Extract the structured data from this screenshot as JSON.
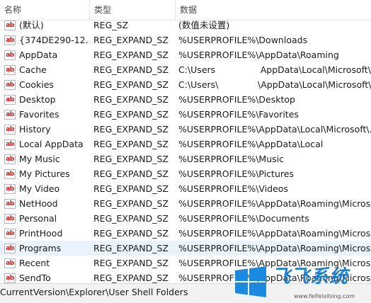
{
  "header": {
    "name": "名称",
    "type": "类型",
    "data": "数据"
  },
  "icon": {
    "label": "ab",
    "color": "#d01616"
  },
  "rows": [
    {
      "name": "(默认)",
      "type": "REG_SZ",
      "data": "(数值未设置)"
    },
    {
      "name": "{374DE290-12...",
      "type": "REG_EXPAND_SZ",
      "data": "%USERPROFILE%\\Downloads"
    },
    {
      "name": "AppData",
      "type": "REG_EXPAND_SZ",
      "data": "%USERPROFILE%\\AppData\\Roaming"
    },
    {
      "name": "Cache",
      "type": "REG_EXPAND_SZ",
      "data": "C:\\Users                AppData\\Local\\Microsoft\\Wi..."
    },
    {
      "name": "Cookies",
      "type": "REG_EXPAND_SZ",
      "data": "C:\\Users\\              \\AppData\\Local\\Microsoft\\Wi..."
    },
    {
      "name": "Desktop",
      "type": "REG_EXPAND_SZ",
      "data": "%USERPROFILE%\\Desktop"
    },
    {
      "name": "Favorites",
      "type": "REG_EXPAND_SZ",
      "data": "%USERPROFILE%\\Favorites"
    },
    {
      "name": "History",
      "type": "REG_EXPAND_SZ",
      "data": "%USERPROFILE%\\AppData\\Local\\Microsoft\\..."
    },
    {
      "name": "Local AppData",
      "type": "REG_EXPAND_SZ",
      "data": "%USERPROFILE%\\AppData\\Local"
    },
    {
      "name": "My Music",
      "type": "REG_EXPAND_SZ",
      "data": "%USERPROFILE%\\Music"
    },
    {
      "name": "My Pictures",
      "type": "REG_EXPAND_SZ",
      "data": "%USERPROFILE%\\Pictures"
    },
    {
      "name": "My Video",
      "type": "REG_EXPAND_SZ",
      "data": "%USERPROFILE%\\Videos"
    },
    {
      "name": "NetHood",
      "type": "REG_EXPAND_SZ",
      "data": "%USERPROFILE%\\AppData\\Roaming\\Micros..."
    },
    {
      "name": "Personal",
      "type": "REG_EXPAND_SZ",
      "data": "%USERPROFILE%\\Documents"
    },
    {
      "name": "PrintHood",
      "type": "REG_EXPAND_SZ",
      "data": "%USERPROFILE%\\AppData\\Roaming\\Micros..."
    },
    {
      "name": "Programs",
      "type": "REG_EXPAND_SZ",
      "data": "%USERPROFILE%\\AppData\\Roaming\\Micros...",
      "selected": true
    },
    {
      "name": "Recent",
      "type": "REG_EXPAND_SZ",
      "data": "%USERPROFILE%\\AppData\\Roaming\\Micros..."
    },
    {
      "name": "SendTo",
      "type": "REG_EXPAND_SZ",
      "data": "%USERPROFILE%\\AppData\\Roaming\\Micros..."
    }
  ],
  "status": {
    "path": "CurrentVersion\\Explorer\\User Shell Folders"
  },
  "watermark": {
    "text": "飞飞系统",
    "url": "www.feifeixitong.com",
    "color": "#1a7fd4"
  }
}
